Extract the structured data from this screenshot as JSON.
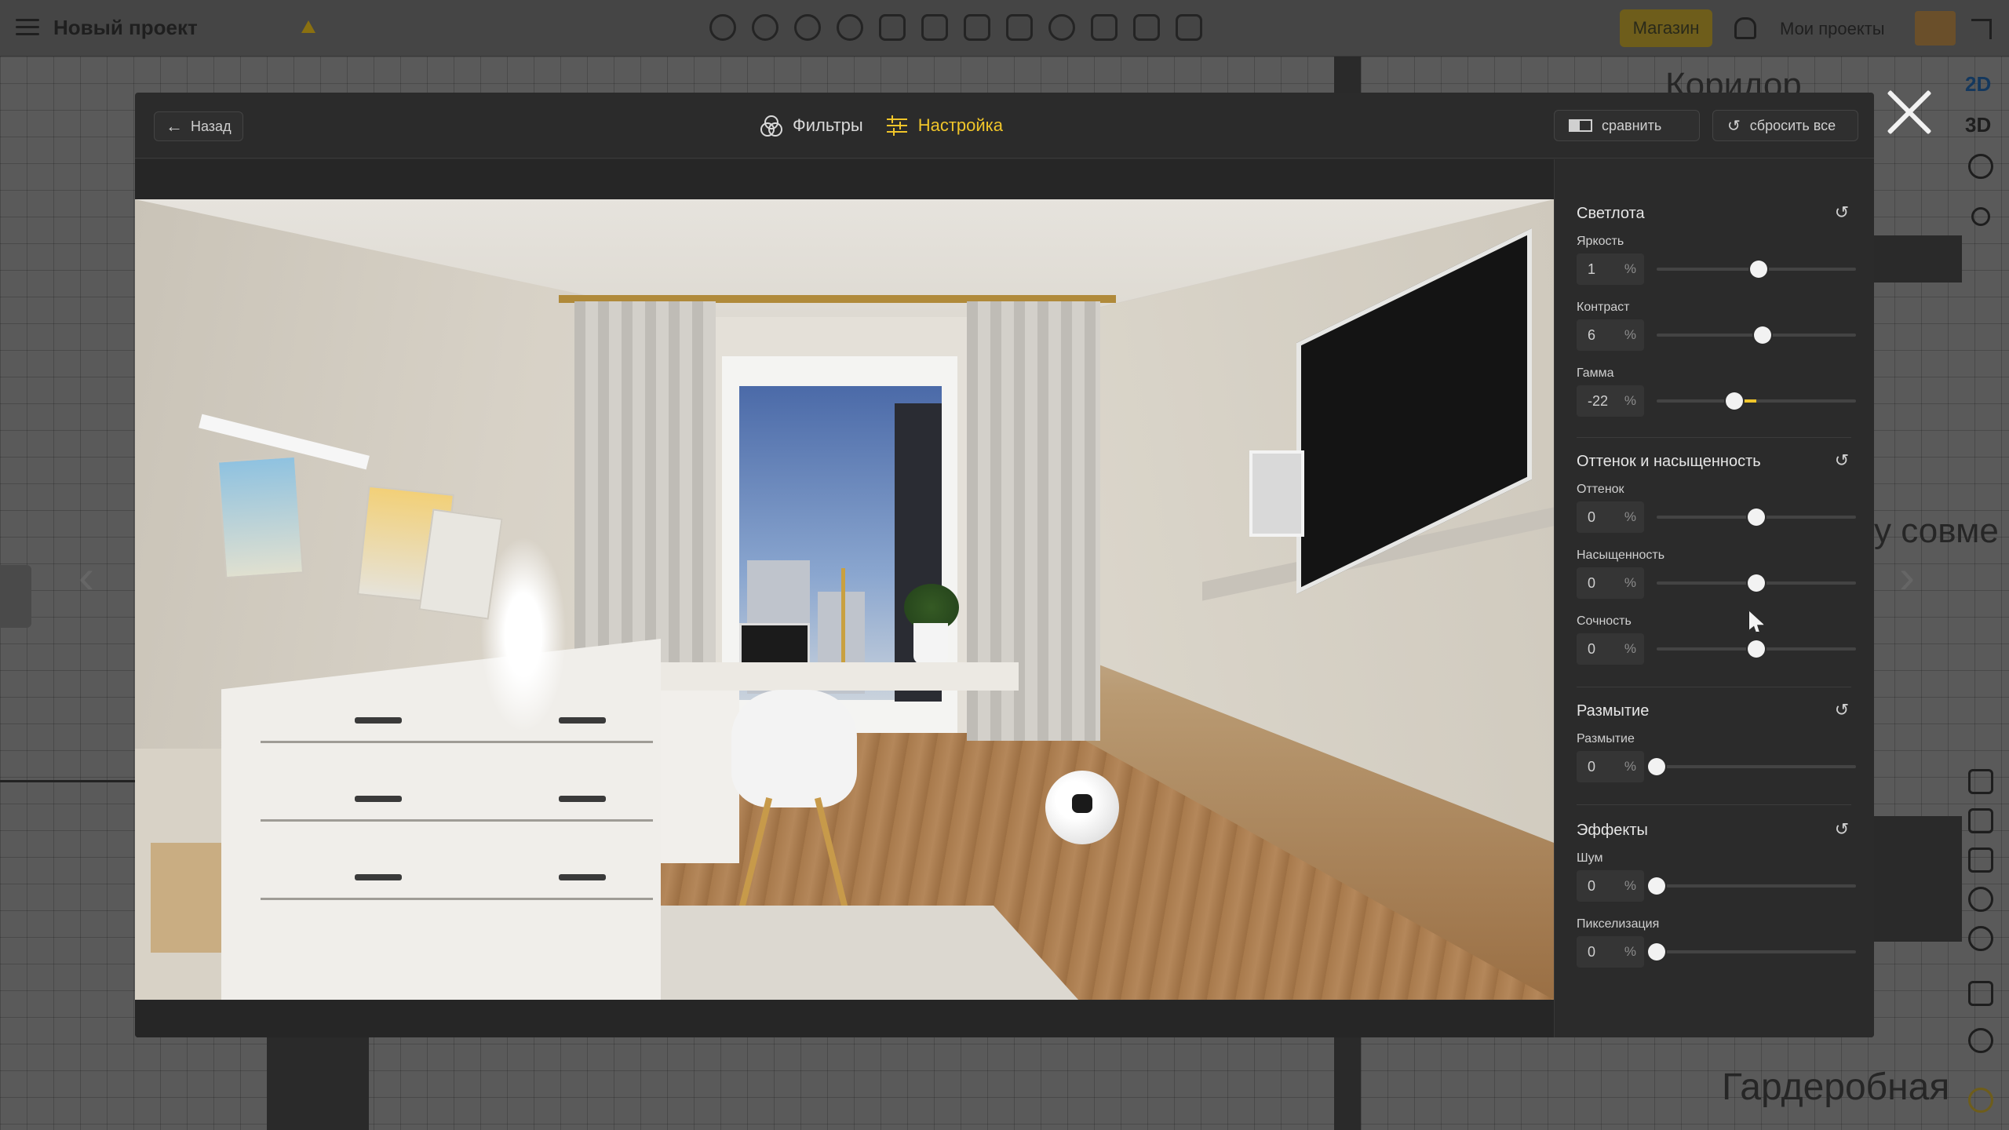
{
  "app": {
    "project_title": "Новый проект",
    "shop_label": "Магазин",
    "my_projects_label": "Мои проекты",
    "view_2d": "2D",
    "view_3d": "3D",
    "bg_room_label_1": "Коридор",
    "bg_room_label_2": "Гардеробная",
    "bg_partial_text": "у совме"
  },
  "modal": {
    "back_label": "Назад",
    "tabs": [
      {
        "label": "Фильтры",
        "icon": "filters-icon",
        "active": false
      },
      {
        "label": "Настройка",
        "icon": "settings-sliders-icon",
        "active": true
      }
    ],
    "compare_label": "сравнить",
    "reset_all_label": "сбросить все"
  },
  "panel": {
    "unit": "%",
    "accent_color": "#f0c52a",
    "sections": [
      {
        "title": "Светлота",
        "params": [
          {
            "label": "Яркость",
            "value": "1",
            "level": 0.51
          },
          {
            "label": "Контраст",
            "value": "6",
            "level": 0.53
          },
          {
            "label": "Гамма",
            "value": "-22",
            "level": 0.39
          }
        ]
      },
      {
        "title": "Оттенок и насыщенность",
        "params": [
          {
            "label": "Оттенок",
            "value": "0",
            "level": 0.5
          },
          {
            "label": "Насыщенность",
            "value": "0",
            "level": 0.5
          },
          {
            "label": "Сочность",
            "value": "0",
            "level": 0.5
          }
        ]
      },
      {
        "title": "Размытие",
        "params": [
          {
            "label": "Размытие",
            "value": "0",
            "level": 0.0
          }
        ]
      },
      {
        "title": "Эффекты",
        "params": [
          {
            "label": "Шум",
            "value": "0",
            "level": 0.0
          },
          {
            "label": "Пикселизация",
            "value": "0",
            "level": 0.0
          }
        ]
      }
    ]
  }
}
